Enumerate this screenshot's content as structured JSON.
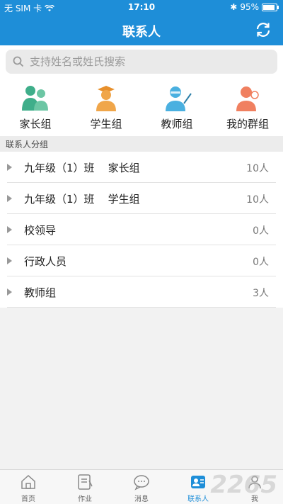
{
  "status": {
    "carrier": "无 SIM 卡",
    "time": "17:10",
    "battery": "95%"
  },
  "header": {
    "title": "联系人"
  },
  "search": {
    "placeholder": "支持姓名或姓氏搜索"
  },
  "groups": [
    {
      "label": "家长组",
      "icon": "parents-icon"
    },
    {
      "label": "学生组",
      "icon": "student-icon"
    },
    {
      "label": "教师组",
      "icon": "teacher-icon"
    },
    {
      "label": "我的群组",
      "icon": "my-group-icon"
    }
  ],
  "section": {
    "title": "联系人分组"
  },
  "contacts": [
    {
      "name": "九年级（1）班    家长组",
      "count": "10人"
    },
    {
      "name": "九年级（1）班    学生组",
      "count": "10人"
    },
    {
      "name": "校领导",
      "count": "0人"
    },
    {
      "name": "行政人员",
      "count": "0人"
    },
    {
      "name": "教师组",
      "count": "3人"
    }
  ],
  "tabs": [
    {
      "label": "首页",
      "icon": "home-icon"
    },
    {
      "label": "作业",
      "icon": "homework-icon"
    },
    {
      "label": "消息",
      "icon": "message-icon"
    },
    {
      "label": "联系人",
      "icon": "contacts-icon",
      "active": true
    },
    {
      "label": "我",
      "icon": "me-icon"
    }
  ],
  "watermark": "2265",
  "colors": {
    "primary": "#1e8ed8",
    "parents": "#3fae8a",
    "student": "#f0a64a",
    "teacher": "#4ab0e0",
    "mygroup": "#f08060"
  }
}
